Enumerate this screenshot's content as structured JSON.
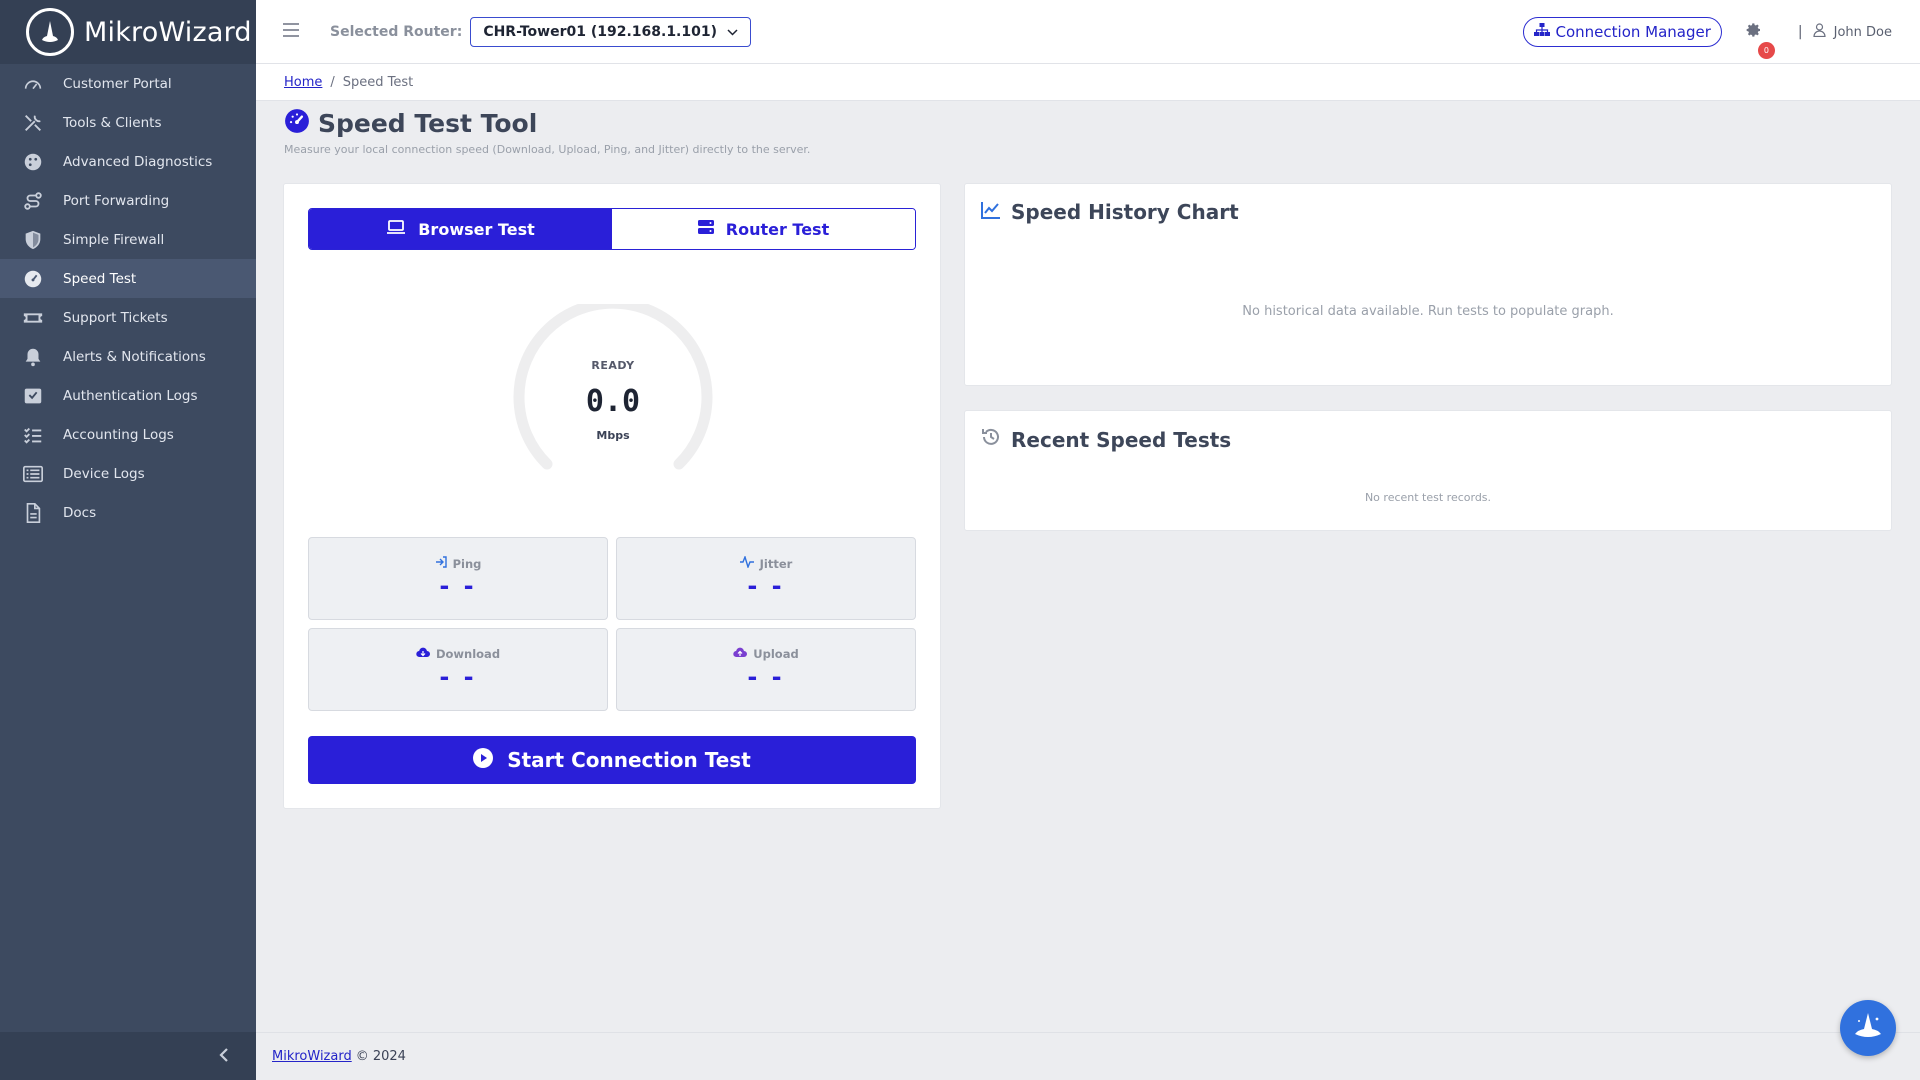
{
  "brand": {
    "name": "MikroWizard"
  },
  "sidebar": {
    "items": [
      {
        "label": "Customer Portal",
        "icon": "dashboard-gauge-icon",
        "active": false
      },
      {
        "label": "Tools & Clients",
        "icon": "tools-icon",
        "active": false
      },
      {
        "label": "Advanced Diagnostics",
        "icon": "palette-icon",
        "active": false
      },
      {
        "label": "Port Forwarding",
        "icon": "route-icon",
        "active": false
      },
      {
        "label": "Simple Firewall",
        "icon": "shield-icon",
        "active": false
      },
      {
        "label": "Speed Test",
        "icon": "speedometer-icon",
        "active": true
      },
      {
        "label": "Support Tickets",
        "icon": "ticket-icon",
        "active": false
      },
      {
        "label": "Alerts & Notifications",
        "icon": "bell-icon",
        "active": false
      },
      {
        "label": "Authentication Logs",
        "icon": "inbox-check-icon",
        "active": false
      },
      {
        "label": "Accounting Logs",
        "icon": "checklist-icon",
        "active": false
      },
      {
        "label": "Device Logs",
        "icon": "list-icon",
        "active": false
      },
      {
        "label": "Docs",
        "icon": "document-icon",
        "active": false
      }
    ]
  },
  "header": {
    "selected_router_label": "Selected Router:",
    "router_value": "CHR-Tower01 (192.168.1.101)",
    "connection_manager": "Connection Manager",
    "notification_count": "0",
    "separator": "|",
    "user_name": "John Doe"
  },
  "breadcrumb": {
    "home": "Home",
    "sep": "/",
    "current": "Speed Test"
  },
  "page": {
    "title": "Speed Test Tool",
    "subtitle": "Measure your local connection speed (Download, Upload, Ping, and Jitter) directly to the server."
  },
  "tabs": {
    "browser": "Browser Test",
    "router": "Router Test"
  },
  "gauge": {
    "status": "READY",
    "value": "0.0",
    "unit": "Mbps"
  },
  "stats": {
    "ping": {
      "label": "Ping",
      "value": "- -"
    },
    "jitter": {
      "label": "Jitter",
      "value": "- -"
    },
    "download": {
      "label": "Download",
      "value": "- -"
    },
    "upload": {
      "label": "Upload",
      "value": "- -"
    }
  },
  "start_button": "Start Connection Test",
  "history": {
    "title": "Speed History Chart",
    "empty": "No historical data available. Run tests to populate graph."
  },
  "recent": {
    "title": "Recent Speed Tests",
    "empty": "No recent test records."
  },
  "footer": {
    "link": "MikroWizard",
    "copyright": "© 2024"
  },
  "colors": {
    "accent": "#2a1fd8",
    "sidebar": "#3d4a60",
    "fab": "#3071de",
    "badge": "#e64949"
  }
}
